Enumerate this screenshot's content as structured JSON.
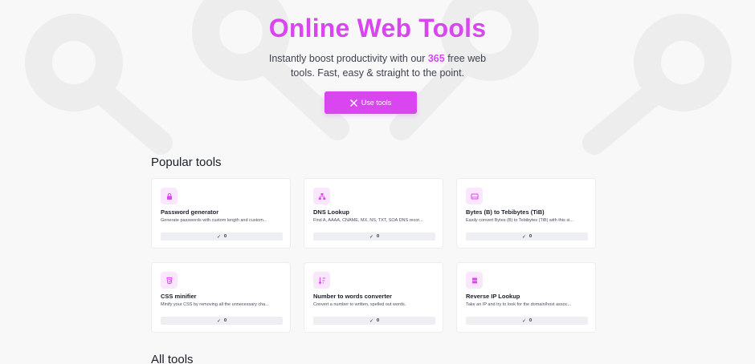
{
  "hero": {
    "title": "Online Web Tools",
    "subtitle_before": "Instantly boost productivity with our ",
    "subtitle_count": "365",
    "subtitle_after": " free web tools. Fast, easy & straight to the point.",
    "cta_label": "Use tools"
  },
  "popular": {
    "heading": "Popular tools",
    "tools": [
      {
        "name": "Password generator",
        "desc": "Generate passwords with custom length and custom...",
        "count": "0",
        "icon": "lock-icon"
      },
      {
        "name": "DNS Lookup",
        "desc": "Find A, AAAA, CNAME, MX, NS, TXT, SOA DNS recor...",
        "count": "0",
        "icon": "network-icon"
      },
      {
        "name": "Bytes (B) to Tebibytes (TiB)",
        "desc": "Easily convert Bytes (B) to Tebibytes (TiB) with this si...",
        "count": "0",
        "icon": "hard-drive-icon"
      },
      {
        "name": "CSS minifier",
        "desc": "Minify your CSS by removing all the unnecessary cha...",
        "count": "0",
        "icon": "css-icon"
      },
      {
        "name": "Number to words converter",
        "desc": "Convert a number to written, spelled out words.",
        "count": "0",
        "icon": "sort-numeric-icon"
      },
      {
        "name": "Reverse IP Lookup",
        "desc": "Take an IP and try to look for the domain/host assoc...",
        "count": "0",
        "icon": "server-icon"
      }
    ]
  },
  "all": {
    "heading": "All tools"
  },
  "colors": {
    "accent": "#d946ef",
    "icon_bg": "#fbe7fd"
  }
}
